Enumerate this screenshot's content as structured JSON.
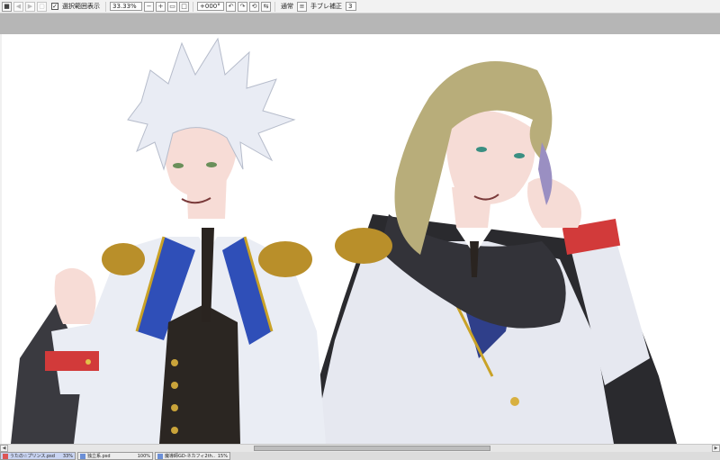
{
  "toolbar": {
    "selection_display_checked": "✓",
    "selection_display_label": "選択範囲表示",
    "zoom": "33.33%",
    "rotation": "+000°",
    "blend_mode": "通常",
    "stabilizer_label": "手ブレ補正",
    "stabilizer_value": "3"
  },
  "tabs": [
    {
      "name": "うたの☆プリンス.psd",
      "zoom": "33%"
    },
    {
      "name": "独立系.psd",
      "zoom": "100%"
    },
    {
      "name": "魔導師GD-ネカフィ2th...",
      "zoom": "15%"
    }
  ],
  "colors": {
    "accent": "#c9d4f2",
    "canvas": "#ffffff",
    "workspace": "#b6b6b6",
    "uniform_blue": "#2f4fb8",
    "uniform_gold": "#c9a227",
    "cuff_red": "#d23a3a"
  }
}
